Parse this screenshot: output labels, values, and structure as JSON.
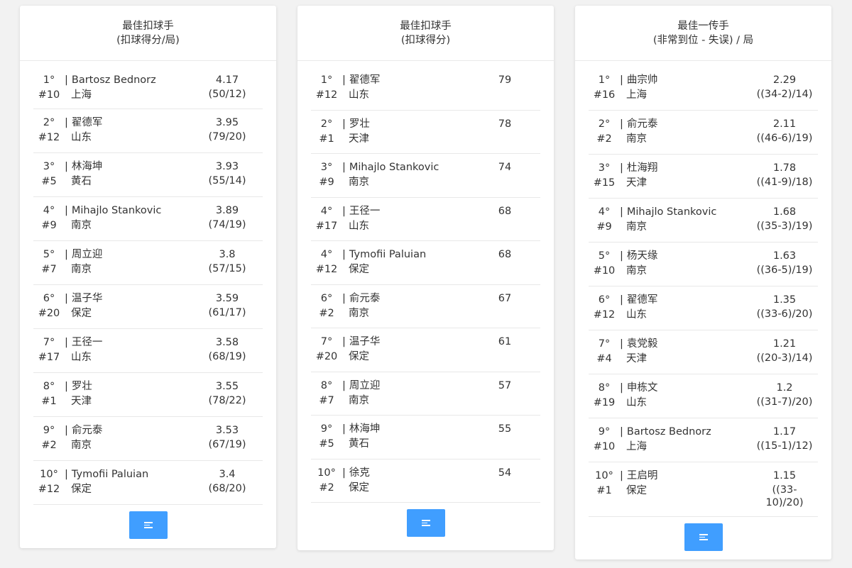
{
  "panels": [
    {
      "title_line1": "最佳扣球手",
      "title_line2": "(扣球得分/局)",
      "rows": [
        {
          "rank": "1°",
          "number": "#10",
          "name": "Bartosz Bednorz",
          "team": "上海",
          "value": "4.17",
          "ratio": "(50/12)"
        },
        {
          "rank": "2°",
          "number": "#12",
          "name": "翟德军",
          "team": "山东",
          "value": "3.95",
          "ratio": "(79/20)"
        },
        {
          "rank": "3°",
          "number": "#5",
          "name": "林海坤",
          "team": "黄石",
          "value": "3.93",
          "ratio": "(55/14)"
        },
        {
          "rank": "4°",
          "number": "#9",
          "name": "Mihajlo Stankovic",
          "team": "南京",
          "value": "3.89",
          "ratio": "(74/19)"
        },
        {
          "rank": "5°",
          "number": "#7",
          "name": "周立迎",
          "team": "南京",
          "value": "3.8",
          "ratio": "(57/15)"
        },
        {
          "rank": "6°",
          "number": "#20",
          "name": "温子华",
          "team": "保定",
          "value": "3.59",
          "ratio": "(61/17)"
        },
        {
          "rank": "7°",
          "number": "#17",
          "name": "王径一",
          "team": "山东",
          "value": "3.58",
          "ratio": "(68/19)"
        },
        {
          "rank": "8°",
          "number": "#1",
          "name": "罗壮",
          "team": "天津",
          "value": "3.55",
          "ratio": "(78/22)"
        },
        {
          "rank": "9°",
          "number": "#2",
          "name": "俞元泰",
          "team": "南京",
          "value": "3.53",
          "ratio": "(67/19)"
        },
        {
          "rank": "10°",
          "number": "#12",
          "name": "Tymofii Paluian",
          "team": "保定",
          "value": "3.4",
          "ratio": "(68/20)"
        }
      ]
    },
    {
      "title_line1": "最佳扣球手",
      "title_line2": "(扣球得分)",
      "rows": [
        {
          "rank": "1°",
          "number": "#12",
          "name": "翟德军",
          "team": "山东",
          "value": "79",
          "ratio": ""
        },
        {
          "rank": "2°",
          "number": "#1",
          "name": "罗壮",
          "team": "天津",
          "value": "78",
          "ratio": ""
        },
        {
          "rank": "3°",
          "number": "#9",
          "name": "Mihajlo Stankovic",
          "team": "南京",
          "value": "74",
          "ratio": ""
        },
        {
          "rank": "4°",
          "number": "#17",
          "name": "王径一",
          "team": "山东",
          "value": "68",
          "ratio": ""
        },
        {
          "rank": "4°",
          "number": "#12",
          "name": "Tymofii Paluian",
          "team": "保定",
          "value": "68",
          "ratio": ""
        },
        {
          "rank": "6°",
          "number": "#2",
          "name": "俞元泰",
          "team": "南京",
          "value": "67",
          "ratio": ""
        },
        {
          "rank": "7°",
          "number": "#20",
          "name": "温子华",
          "team": "保定",
          "value": "61",
          "ratio": ""
        },
        {
          "rank": "8°",
          "number": "#7",
          "name": "周立迎",
          "team": "南京",
          "value": "57",
          "ratio": ""
        },
        {
          "rank": "9°",
          "number": "#5",
          "name": "林海坤",
          "team": "黄石",
          "value": "55",
          "ratio": ""
        },
        {
          "rank": "10°",
          "number": "#2",
          "name": "徐克",
          "team": "保定",
          "value": "54",
          "ratio": ""
        }
      ]
    },
    {
      "title_line1": "最佳一传手",
      "title_line2": "(非常到位 - 失误) / 局",
      "rows": [
        {
          "rank": "1°",
          "number": "#16",
          "name": "曲宗帅",
          "team": "上海",
          "value": "2.29",
          "ratio": "((34-2)/14)"
        },
        {
          "rank": "2°",
          "number": "#2",
          "name": "俞元泰",
          "team": "南京",
          "value": "2.11",
          "ratio": "((46-6)/19)"
        },
        {
          "rank": "3°",
          "number": "#15",
          "name": "杜海翔",
          "team": "天津",
          "value": "1.78",
          "ratio": "((41-9)/18)"
        },
        {
          "rank": "4°",
          "number": "#9",
          "name": "Mihajlo Stankovic",
          "team": "南京",
          "value": "1.68",
          "ratio": "((35-3)/19)"
        },
        {
          "rank": "5°",
          "number": "#10",
          "name": "杨天缘",
          "team": "南京",
          "value": "1.63",
          "ratio": "((36-5)/19)"
        },
        {
          "rank": "6°",
          "number": "#12",
          "name": "翟德军",
          "team": "山东",
          "value": "1.35",
          "ratio": "((33-6)/20)"
        },
        {
          "rank": "7°",
          "number": "#4",
          "name": "袁党毅",
          "team": "天津",
          "value": "1.21",
          "ratio": "((20-3)/14)"
        },
        {
          "rank": "8°",
          "number": "#19",
          "name": "申栋文",
          "team": "山东",
          "value": "1.2",
          "ratio": "((31-7)/20)"
        },
        {
          "rank": "9°",
          "number": "#10",
          "name": "Bartosz Bednorz",
          "team": "上海",
          "value": "1.17",
          "ratio": "((15-1)/12)"
        },
        {
          "rank": "10°",
          "number": "#1",
          "name": "王启明",
          "team": "保定",
          "value": "1.15",
          "ratio": "((33-10)/20)"
        }
      ]
    }
  ],
  "menu_icon": "list-menu-icon",
  "accent_color": "#409eff"
}
